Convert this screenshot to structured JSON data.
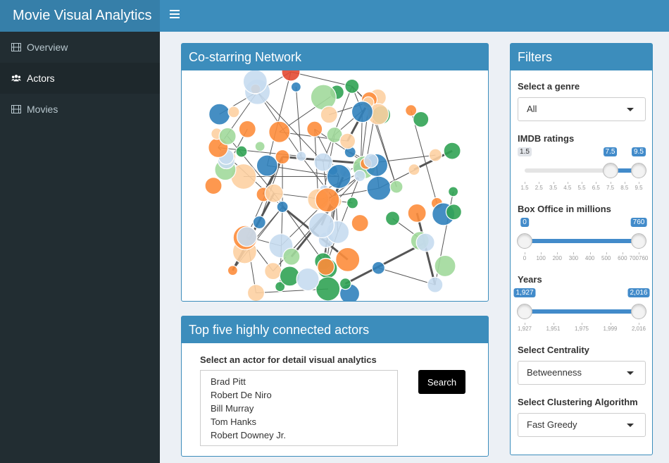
{
  "app": {
    "title": "Movie Visual Analytics"
  },
  "sidebar": {
    "items": [
      {
        "label": "Overview",
        "icon": "film-icon",
        "active": false
      },
      {
        "label": "Actors",
        "icon": "users-icon",
        "active": true
      },
      {
        "label": "Movies",
        "icon": "film-icon",
        "active": false
      }
    ]
  },
  "network": {
    "title": "Co-starring Network"
  },
  "top5": {
    "title": "Top five highly connected actors",
    "select_label": "Select an actor for detail visual analytics",
    "actors": [
      "Brad Pitt",
      "Robert De Niro",
      "Bill Murray",
      "Tom Hanks",
      "Robert Downey Jr."
    ],
    "search_label": "Search"
  },
  "filters": {
    "title": "Filters",
    "genre": {
      "label": "Select a genre",
      "value": "All"
    },
    "imdb": {
      "label": "IMDB ratings",
      "min_label": "1.5",
      "low_label": "7.5",
      "high_label": "9.5",
      "min": 1.5,
      "max": 9.5,
      "low": 7.5,
      "high": 9.5,
      "ticks": [
        "1.5",
        "2.5",
        "3.5",
        "4.5",
        "5.5",
        "6.5",
        "7.5",
        "8.5",
        "9.5"
      ]
    },
    "box_office": {
      "label": "Box Office in millions",
      "low_label": "0",
      "high_label": "760",
      "min": 0,
      "max": 760,
      "low": 0,
      "high": 760,
      "ticks": [
        "0",
        "100",
        "200",
        "300",
        "400",
        "500",
        "600",
        "700760"
      ]
    },
    "years": {
      "label": "Years",
      "low_label": "1,927",
      "high_label": "2,016",
      "min": 1927,
      "max": 2016,
      "low": 1927,
      "high": 2016,
      "ticks": [
        "1,927",
        "1,951",
        "1,975",
        "1,999",
        "2,016"
      ]
    },
    "centrality": {
      "label": "Select Centrality",
      "value": "Betweenness"
    },
    "clustering": {
      "label": "Select Clustering Algorithm",
      "value": "Fast Greedy"
    }
  },
  "colors": {
    "header": "#3c8dbc",
    "logo": "#367fa9",
    "sidebar": "#222d32",
    "node_orange": "#fd8d3c",
    "node_peach": "#fdd0a2",
    "node_green": "#31a354",
    "node_lightgreen": "#a1d99b",
    "node_blue": "#3182bd",
    "node_lightblue": "#c6dbef",
    "node_red": "#e34a33"
  }
}
